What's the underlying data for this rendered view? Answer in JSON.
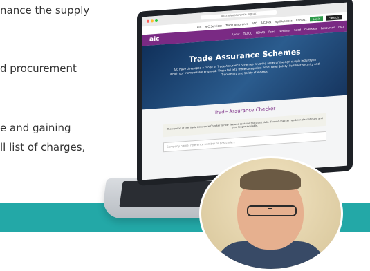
{
  "left_text": {
    "line1": "nance the supply",
    "line2": "d procurement",
    "line3": "e and gaining",
    "line4": "ll list of charges,"
  },
  "browser": {
    "url": "aictradeassurance.org.uk"
  },
  "topnav": {
    "items": [
      "AIC",
      "AIC Services",
      "Trade Assurance",
      "FAQ",
      "AIC/FPA",
      "AgriBusiness",
      "Contact"
    ],
    "login_label": "Login",
    "search_label": "Search"
  },
  "mainnav": {
    "logo": "aic",
    "items": [
      "About",
      "TASCC",
      "FEMAS",
      "Feed",
      "Fertiliser",
      "Seed",
      "Overseas",
      "Resources",
      "FAQ"
    ]
  },
  "hero": {
    "title": "Trade Assurance Schemes",
    "subtitle": "AIC have developed a range of Trade Assurance Schemes covering areas of the Agri-supply industry in which our members are engaged. These fall into three categories: Food, Feed Safety, Fertiliser Security and Traceability and Safety standards."
  },
  "checker": {
    "title": "Trade Assurance Checker",
    "notice": "The version of the Trade Assurance Checker is now live and contains the latest data. The old checker has been discontinued and is no longer available.",
    "input_placeholder": "Company name, reference number or postcode..."
  },
  "colors": {
    "teal_strip": "#23a8a7",
    "purple_nav": "#7a2a84",
    "login_green": "#2e9b4a"
  }
}
